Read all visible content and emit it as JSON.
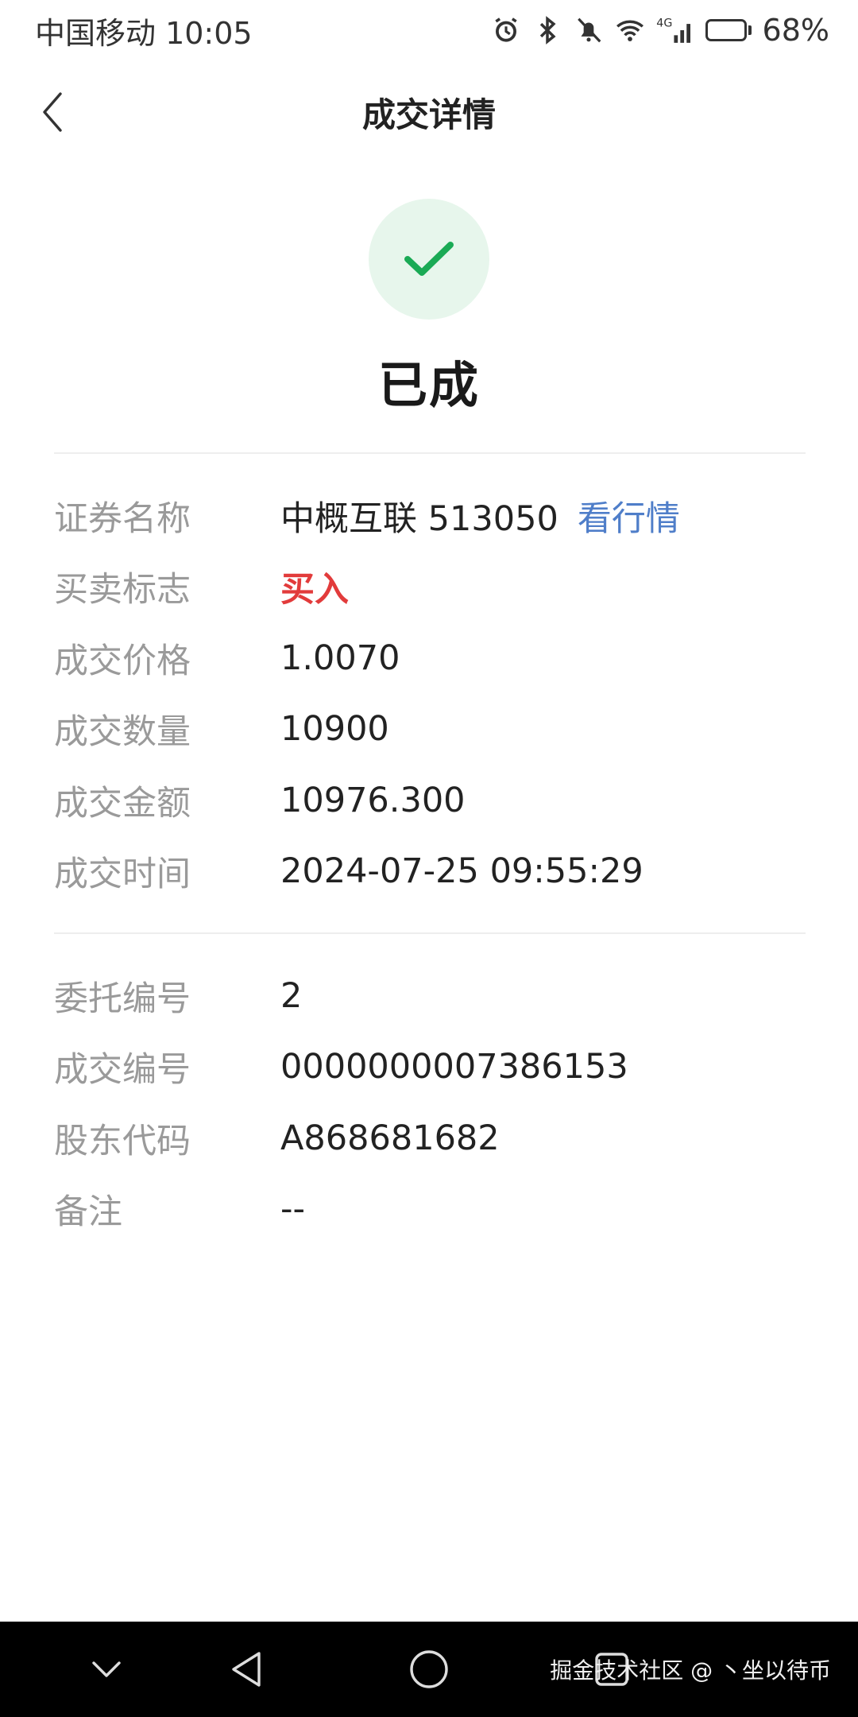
{
  "status_bar": {
    "carrier_time": "中国移动 10:05",
    "network": "4G",
    "battery_percent": "68%",
    "battery_level": 0.68,
    "icons": [
      "alarm-icon",
      "bluetooth-icon",
      "mute-icon",
      "wifi-icon",
      "signal-icon",
      "battery-icon"
    ]
  },
  "header": {
    "title": "成交详情"
  },
  "status": {
    "text": "已成",
    "icon": "check-icon",
    "accent": "#1aaa55",
    "circle_bg": "#e7f6ec"
  },
  "details": [
    {
      "label": "证券名称",
      "value": "中概互联 513050",
      "link": "看行情"
    },
    {
      "label": "买卖标志",
      "value": "买入",
      "color": "#e23b3b"
    },
    {
      "label": "成交价格",
      "value": "1.0070"
    },
    {
      "label": "成交数量",
      "value": "10900"
    },
    {
      "label": "成交金额",
      "value": "10976.300"
    },
    {
      "label": "成交时间",
      "value": "2024-07-25 09:55:29"
    }
  ],
  "extra": [
    {
      "label": "委托编号",
      "value": "2"
    },
    {
      "label": "成交编号",
      "value": "0000000007386153"
    },
    {
      "label": "股东代码",
      "value": "A868681682"
    },
    {
      "label": "备注",
      "value": "--"
    }
  ],
  "system_nav": {
    "keys": [
      "chevron-down-icon",
      "back-triangle-icon",
      "home-circle-icon",
      "recents-square-icon"
    ],
    "watermark": "掘金技术社区 @ 丶坐以待币"
  }
}
